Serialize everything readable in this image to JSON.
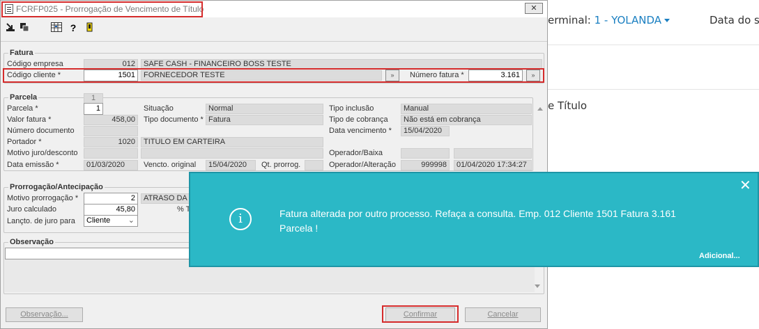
{
  "background_app": {
    "terminal_label": "erminal:",
    "terminal_value": "1 - YOLANDA",
    "data_label": "Data do sis",
    "titulo_text": "e Título"
  },
  "window": {
    "title": "FCRFP025 - Prorrogação de Vencimento de Título",
    "close_label": "✕"
  },
  "toolbar": {
    "icons": [
      "exit-icon",
      "save-icon",
      "calculator-icon",
      "help-icon",
      "info-icon"
    ]
  },
  "fatura": {
    "group_title": "Fatura",
    "codigo_empresa_label": "Código empresa",
    "codigo_empresa_value": "012",
    "empresa_nome": "SAFE CASH - FINANCEIRO BOSS TESTE",
    "codigo_cliente_label": "Código cliente *",
    "codigo_cliente_value": "1501",
    "cliente_nome": "FORNECEDOR TESTE",
    "numero_fatura_label": "Número fatura *",
    "numero_fatura_value": "3.161"
  },
  "parcela": {
    "group_title": "Parcela",
    "counter": "1",
    "parcela_label": "Parcela *",
    "parcela_value": "1",
    "valor_fatura_label": "Valor fatura *",
    "valor_fatura_value": "458,00",
    "numero_documento_label": "Número documento",
    "numero_documento_value": "",
    "portador_label": "Portador *",
    "portador_value": "1020",
    "portador_nome": "TITULO EM CARTEIRA",
    "motivo_juro_label": "Motivo juro/desconto",
    "data_emissao_label": "Data emissão *",
    "data_emissao_value": "01/03/2020",
    "situacao_label": "Situação",
    "situacao_value": "Normal",
    "tipo_documento_label": "Tipo documento *",
    "tipo_documento_value": "Fatura",
    "vencto_original_label": "Vencto. original",
    "vencto_original_value": "15/04/2020",
    "qt_prorrog_label": "Qt. prorrog.",
    "qt_prorrog_value": "",
    "tipo_inclusao_label": "Tipo inclusão",
    "tipo_inclusao_value": "Manual",
    "tipo_cobranca_label": "Tipo de cobrança",
    "tipo_cobranca_value": "Não está em cobrança",
    "data_vencimento_label": "Data vencimento *",
    "data_vencimento_value": "15/04/2020",
    "operador_baixa_label": "Operador/Baixa",
    "operador_alteracao_label": "Operador/Alteração",
    "operador_alteracao_value": "999998",
    "operador_alteracao_datetime": "01/04/2020 17:34:27"
  },
  "prorrogacao": {
    "group_title": "Prorrogação/Antecipação",
    "motivo_label": "Motivo prorrogação *",
    "motivo_value": "2",
    "motivo_nome": "ATRASO DA T",
    "juro_calculado_label": "Juro calculado",
    "juro_calculado_value": "45,80",
    "pct_label": "% T",
    "lancto_juro_label": "Lançto. de juro para",
    "lancto_juro_value": "Cliente"
  },
  "observacao": {
    "group_title": "Observação",
    "text": ""
  },
  "buttons": {
    "observacao": "Observação...",
    "confirmar": "Confirmar",
    "cancelar": "Cancelar"
  },
  "notification": {
    "message": "Fatura alterada por outro processo. Refaça a consulta. Emp. 012 Cliente 1501 Fatura 3.161 Parcela !",
    "more_label": "Adicional...",
    "close_label": "✕",
    "info_glyph": "i",
    "color": "#2bb8c6"
  }
}
